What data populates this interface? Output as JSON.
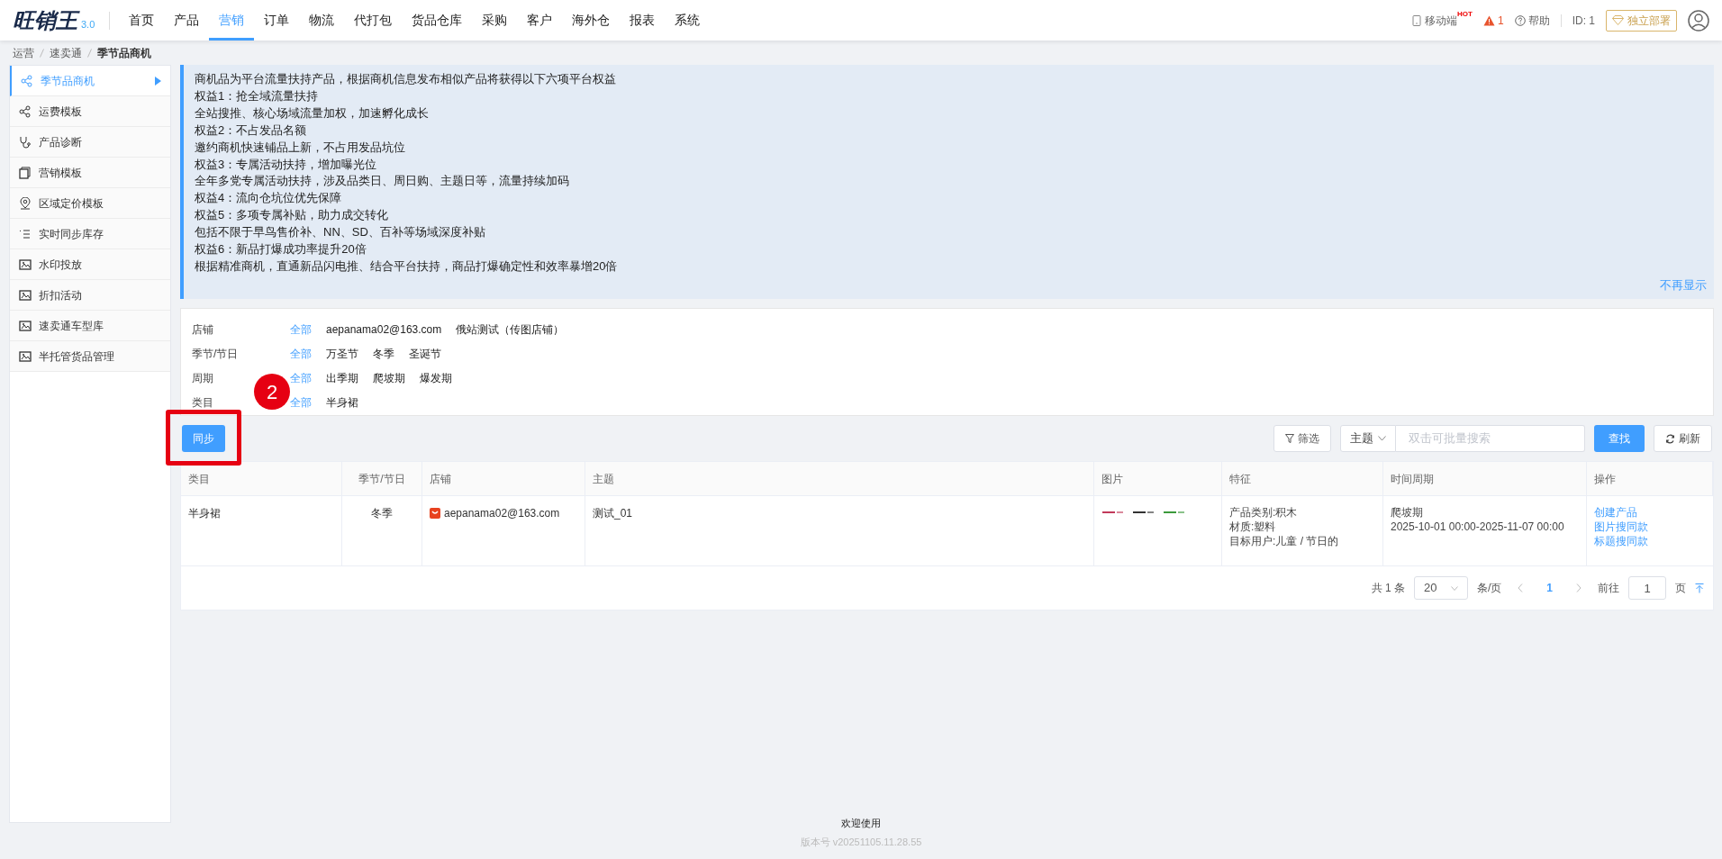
{
  "header": {
    "logo": "旺销王",
    "logo_version": "3.0",
    "nav": [
      {
        "label": "首页",
        "selected": false
      },
      {
        "label": "产品",
        "selected": false
      },
      {
        "label": "营销",
        "selected": true
      },
      {
        "label": "订单",
        "selected": false
      },
      {
        "label": "物流",
        "selected": false
      },
      {
        "label": "代打包",
        "selected": false
      },
      {
        "label": "货品仓库",
        "selected": false
      },
      {
        "label": "采购",
        "selected": false
      },
      {
        "label": "客户",
        "selected": false
      },
      {
        "label": "海外仓",
        "selected": false
      },
      {
        "label": "报表",
        "selected": false
      },
      {
        "label": "系统",
        "selected": false
      }
    ],
    "mobile": "移动端",
    "hot_badge": "HOT",
    "alert_count": "1",
    "help": "帮助",
    "user_id": "ID: 1",
    "deploy_button": "独立部署"
  },
  "breadcrumb": [
    "运营",
    "速卖通",
    "季节品商机"
  ],
  "sidebar": {
    "items": [
      {
        "label": "季节品商机",
        "selected": true
      },
      {
        "label": "运费模板",
        "selected": false
      },
      {
        "label": "产品诊断",
        "selected": false
      },
      {
        "label": "营销模板",
        "selected": false
      },
      {
        "label": "区域定价模板",
        "selected": false
      },
      {
        "label": "实时同步库存",
        "selected": false
      },
      {
        "label": "水印投放",
        "selected": false
      },
      {
        "label": "折扣活动",
        "selected": false
      },
      {
        "label": "速卖通车型库",
        "selected": false
      },
      {
        "label": "半托管货品管理",
        "selected": false
      }
    ]
  },
  "notice": {
    "lines": [
      "商机品为平台流量扶持产品，根据商机信息发布相似产品将获得以下六项平台权益",
      "权益1：抢全域流量扶持",
      "全站搜推、核心场域流量加权，加速孵化成长",
      "权益2：不占发品名额",
      "邀约商机快速铺品上新，不占用发品坑位",
      "权益3：专属活动扶持，增加曝光位",
      "全年多党专属活动扶持，涉及品类日、周日购、主题日等，流量持续加码",
      "权益4：流向仓坑位优先保障",
      "权益5：多项专属补贴，助力成交转化",
      "包括不限于早鸟售价补、NN、SD、百补等场域深度补贴",
      "权益6：新品打爆成功率提升20倍",
      "根据精准商机，直通新品闪电推、结合平台扶持，商品打爆确定性和效率暴增20倍"
    ],
    "dismiss": "不再显示"
  },
  "filters": [
    {
      "label": "店铺",
      "options": [
        {
          "text": "全部",
          "selected": true
        },
        {
          "text": "aepanama02@163.com",
          "selected": false
        },
        {
          "text": "俄站测试（传图店铺）",
          "selected": false
        }
      ]
    },
    {
      "label": "季节/节日",
      "options": [
        {
          "text": "全部",
          "selected": true
        },
        {
          "text": "万圣节",
          "selected": false
        },
        {
          "text": "冬季",
          "selected": false
        },
        {
          "text": "圣诞节",
          "selected": false
        }
      ]
    },
    {
      "label": "周期",
      "options": [
        {
          "text": "全部",
          "selected": true
        },
        {
          "text": "出季期",
          "selected": false
        },
        {
          "text": "爬坡期",
          "selected": false
        },
        {
          "text": "爆发期",
          "selected": false
        }
      ]
    },
    {
      "label": "类目",
      "options": [
        {
          "text": "全部",
          "selected": true
        },
        {
          "text": "半身裙",
          "selected": false
        }
      ]
    }
  ],
  "annotation": {
    "step": "2"
  },
  "toolbar": {
    "sync_button": "同步",
    "filter_button": "筛选",
    "search_field": "主题",
    "search_placeholder": "双击可批量搜索",
    "find_button": "查找",
    "refresh_button": "刷新"
  },
  "table": {
    "columns": [
      "类目",
      "季节/节日",
      "店铺",
      "主题",
      "图片",
      "特征",
      "时间周期",
      "操作"
    ],
    "rows": [
      {
        "category": "半身裙",
        "season": "冬季",
        "shop": "aepanama02@163.com",
        "theme": "测试_01",
        "images": [
          {
            "kind": "picture"
          },
          {
            "kind": "picture"
          },
          {
            "kind": "picture"
          }
        ],
        "features": [
          "产品类别:积木",
          "材质:塑料",
          "目标用户:儿童 / 节日的"
        ],
        "period": [
          "爬坡期",
          "2025-10-01 00:00-2025-11-07 00:00"
        ],
        "actions": [
          "创建产品",
          "图片搜同款",
          "标题搜同款"
        ]
      }
    ]
  },
  "pagination": {
    "total": "共 1 条",
    "page_size": "20",
    "per_page": "条/页",
    "current_page": "1",
    "goto": "前往",
    "goto_value": "1",
    "page_unit": "页"
  },
  "footer": {
    "welcome": "欢迎使用",
    "version": "版本号 v20251105.11.28.55"
  }
}
